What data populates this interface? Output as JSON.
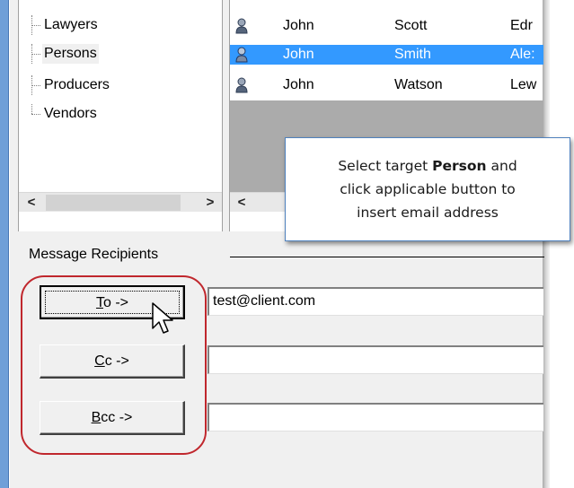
{
  "tree": {
    "items": [
      {
        "label": "Lawyers",
        "selected": false
      },
      {
        "label": "Persons",
        "selected": true
      },
      {
        "label": "Producers",
        "selected": false
      },
      {
        "label": "Vendors",
        "selected": false
      }
    ]
  },
  "list": {
    "rows": [
      {
        "first": "John",
        "last": "Scott",
        "extra": "Edr",
        "selected": false
      },
      {
        "first": "John",
        "last": "Smith",
        "extra": "Ale:",
        "selected": true
      },
      {
        "first": "John",
        "last": "Watson",
        "extra": "Lew",
        "selected": false
      }
    ],
    "row_icon": "person-icon"
  },
  "scroll": {
    "left_arrow": "<",
    "right_arrow": ">"
  },
  "callout": {
    "line1_prefix": "Select target ",
    "line1_bold": "Person",
    "line1_suffix": " and",
    "line2": "click applicable button to",
    "line3": "insert email address"
  },
  "recipients": {
    "group_label": "Message Recipients",
    "to": {
      "mnemonic": "T",
      "label_rest": "o ->",
      "value": "test@client.com"
    },
    "cc": {
      "mnemonic": "C",
      "label_rest": "c ->",
      "value": ""
    },
    "bcc": {
      "mnemonic": "B",
      "label_rest": "cc ->",
      "value": ""
    }
  },
  "colors": {
    "selection": "#3399ff",
    "highlight_oval": "#c0272d",
    "callout_border": "#4f81bd",
    "window_frame": "#6f9fd8"
  }
}
